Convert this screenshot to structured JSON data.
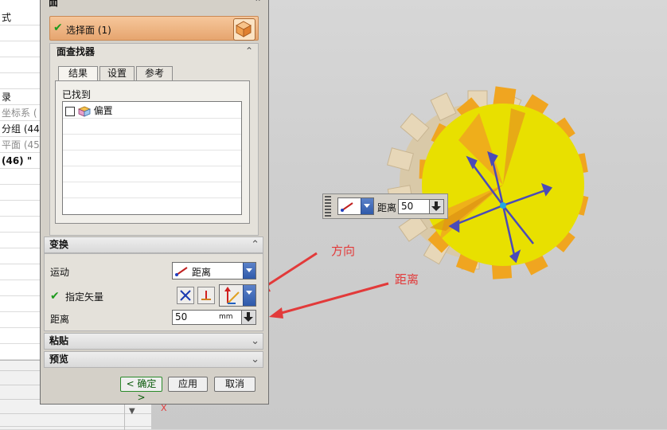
{
  "navigator": {
    "rows": [
      {
        "text": "式",
        "style": "normal"
      },
      {
        "text": "",
        "style": "normal"
      },
      {
        "text": "",
        "style": "normal"
      },
      {
        "text": "",
        "style": "normal"
      },
      {
        "text": "",
        "style": "normal"
      },
      {
        "text": "录",
        "style": "normal"
      },
      {
        "text": "坐标系 (",
        "style": "grey"
      },
      {
        "text": "分组 (44",
        "style": "normal"
      },
      {
        "text": "平面 (45",
        "style": "grey"
      },
      {
        "text": "(46) \"",
        "style": "bold"
      },
      {
        "text": "",
        "style": "normal"
      },
      {
        "text": "",
        "style": "normal"
      },
      {
        "text": "",
        "style": "normal"
      },
      {
        "text": "",
        "style": "normal"
      },
      {
        "text": "",
        "style": "normal"
      },
      {
        "text": "",
        "style": "normal"
      },
      {
        "text": "",
        "style": "normal"
      },
      {
        "text": "",
        "style": "normal"
      },
      {
        "text": "",
        "style": "normal"
      },
      {
        "text": "",
        "style": "normal"
      },
      {
        "text": "",
        "style": "normal"
      },
      {
        "text": "",
        "style": "normal"
      }
    ]
  },
  "dialog": {
    "title": "面",
    "select_face": {
      "label": "选择面 (1)"
    },
    "face_finder": {
      "title": "面查找器",
      "tabs": [
        {
          "label": "结果",
          "active": true
        },
        {
          "label": "设置",
          "active": false
        },
        {
          "label": "参考",
          "active": false
        }
      ],
      "found_label": "已找到",
      "items": [
        {
          "label": "偏置",
          "checked": false
        }
      ]
    },
    "transform": {
      "title": "变换",
      "motion_label": "运动",
      "motion_value": "距离",
      "vector_label": "指定矢量",
      "distance_label": "距离",
      "distance_value": "50",
      "unit": "mm"
    },
    "paste_title": "粘贴",
    "preview_title": "预览",
    "buttons": {
      "ok": "< 确定 >",
      "apply": "应用",
      "cancel": "取消"
    }
  },
  "float_bar": {
    "label": "距离",
    "value": "50"
  },
  "annotations": {
    "direction": "方向",
    "distance": "距离"
  },
  "axis_label": "X",
  "colors": {
    "accent": "#e6a56f",
    "gear_yellow": "#e8e000",
    "arrow_red": "#e23a3a",
    "vector_blue": "#4a4ab8"
  }
}
